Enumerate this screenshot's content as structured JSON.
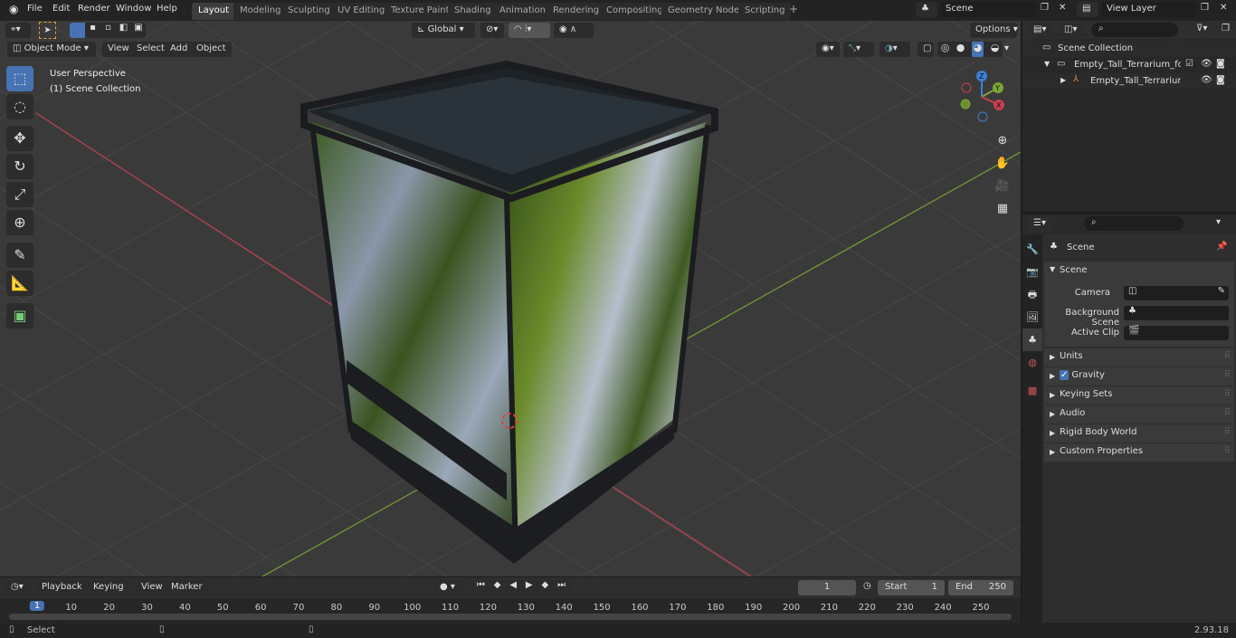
{
  "menu": [
    "File",
    "Edit",
    "Render",
    "Window",
    "Help"
  ],
  "workspaces": [
    "Layout",
    "Modeling",
    "Sculpting",
    "UV Editing",
    "Texture Paint",
    "Shading",
    "Animation",
    "Rendering",
    "Compositing",
    "Geometry Nodes",
    "Scripting"
  ],
  "active_workspace": "Layout",
  "scene_name": "Scene",
  "view_layer": "View Layer",
  "viewport": {
    "mode": "Object Mode",
    "menus": [
      "View",
      "Select",
      "Add",
      "Object"
    ],
    "orientation": "Global",
    "options": "Options",
    "overlay_line1": "User Perspective",
    "overlay_line2": "(1) Scene Collection",
    "gizmo_axes": [
      "Z",
      "Y",
      "X"
    ]
  },
  "outliner": {
    "root": "Scene Collection",
    "items": [
      "Empty_Tall_Terrarium_for_Rep",
      "Empty_Tall_Terrarium_for"
    ]
  },
  "properties": {
    "header": "Scene",
    "panel": "Scene",
    "fields": [
      {
        "label": "Camera"
      },
      {
        "label": "Background Scene"
      },
      {
        "label": "Active Clip"
      }
    ],
    "sections": [
      "Units",
      "Gravity",
      "Keying Sets",
      "Audio",
      "Rigid Body World",
      "Custom Properties"
    ],
    "gravity_checked": true
  },
  "timeline": {
    "menus": [
      "Playback",
      "Keying",
      "View",
      "Marker"
    ],
    "current_frame": "1",
    "start_label": "Start",
    "start": "1",
    "end_label": "End",
    "end": "250",
    "ticks": [
      "1",
      "10",
      "20",
      "30",
      "40",
      "50",
      "60",
      "70",
      "80",
      "90",
      "100",
      "110",
      "120",
      "130",
      "140",
      "150",
      "160",
      "170",
      "180",
      "190",
      "200",
      "210",
      "220",
      "230",
      "240",
      "250"
    ]
  },
  "status": {
    "left": "Select",
    "version": "2.93.18"
  },
  "colors": {
    "accent": "#4772b3",
    "x_axis": "#c8404e",
    "y_axis": "#7aa634",
    "z_axis": "#3b7fd9"
  }
}
